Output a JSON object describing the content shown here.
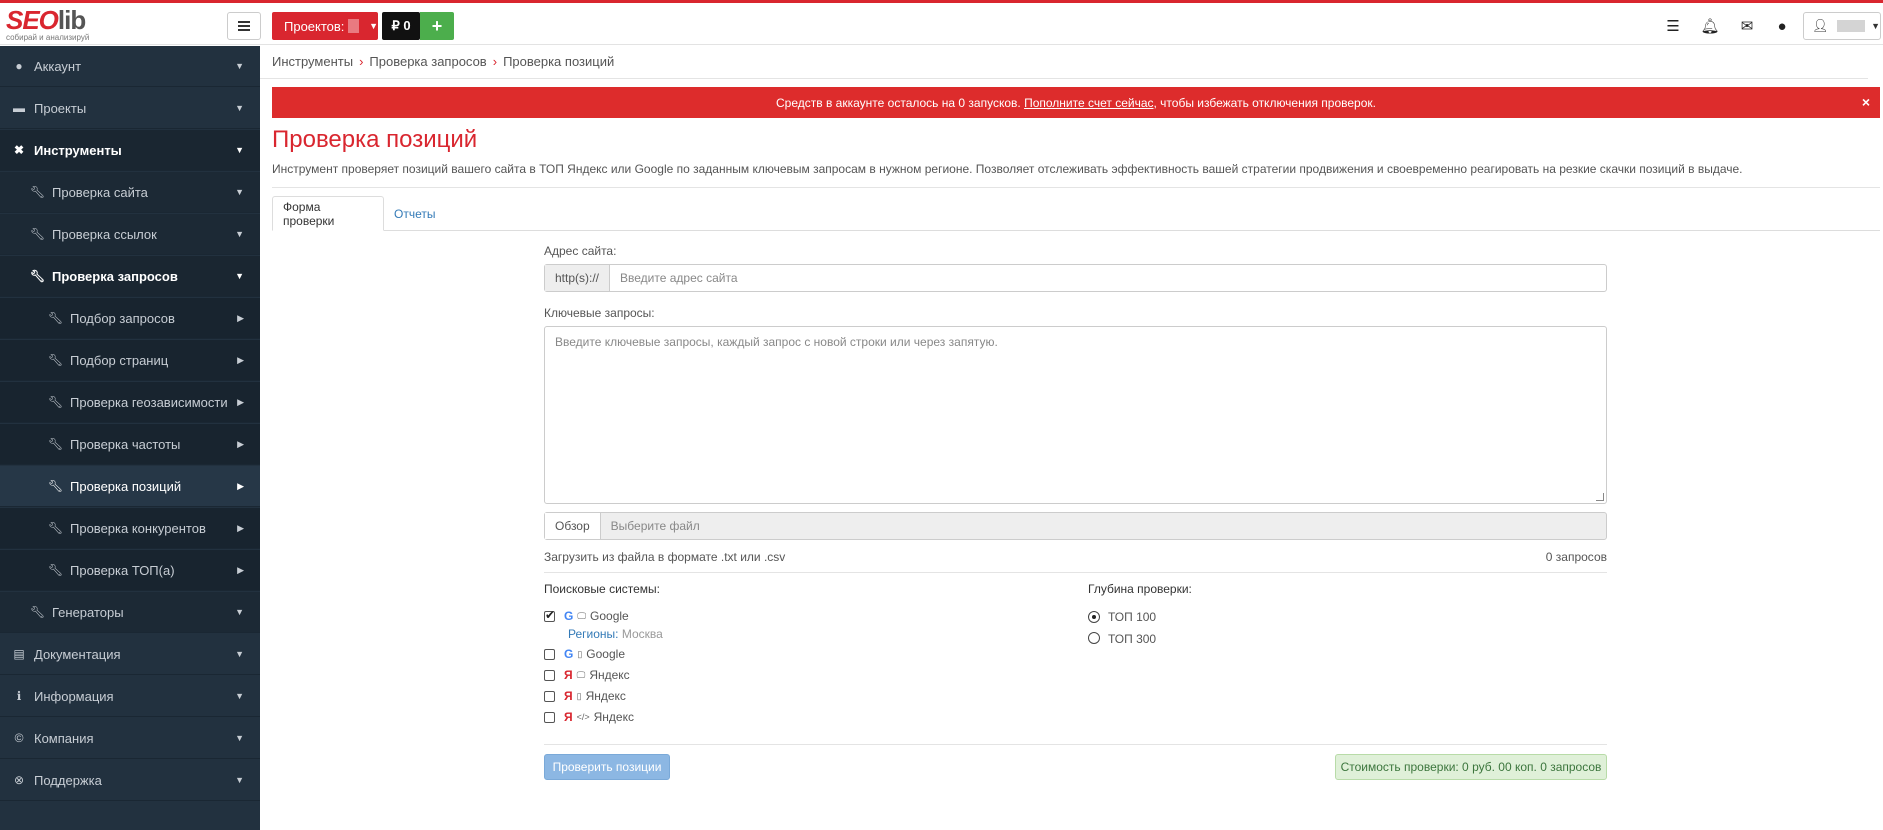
{
  "brand": {
    "logo_seo": "SEO",
    "logo_lib": "lib",
    "tagline": "собирай и анализируй"
  },
  "topbar": {
    "projects_label": "Проектов:",
    "balance_label": "₽ 0",
    "add_label": "+",
    "icons": [
      "checklist-icon",
      "bell-icon",
      "envelope-icon",
      "chat-icon",
      "user-icon"
    ]
  },
  "sidebar": {
    "items": [
      {
        "label": "Аккаунт",
        "icon": "user-icon"
      },
      {
        "label": "Проекты",
        "icon": "briefcase-icon"
      },
      {
        "label": "Инструменты",
        "icon": "tools-icon"
      },
      {
        "label": "Проверка сайта",
        "icon": "wrench-icon"
      },
      {
        "label": "Проверка ссылок",
        "icon": "wrench-icon"
      },
      {
        "label": "Проверка запросов",
        "icon": "wrench-icon"
      },
      {
        "label": "Подбор запросов",
        "icon": "wrench-icon"
      },
      {
        "label": "Подбор страниц",
        "icon": "wrench-icon"
      },
      {
        "label": "Проверка геозависимости",
        "icon": "wrench-icon"
      },
      {
        "label": "Проверка частоты",
        "icon": "wrench-icon"
      },
      {
        "label": "Проверка позиций",
        "icon": "wrench-icon"
      },
      {
        "label": "Проверка конкурентов",
        "icon": "wrench-icon"
      },
      {
        "label": "Проверка ТОП(а)",
        "icon": "wrench-icon"
      },
      {
        "label": "Генераторы",
        "icon": "wrench-icon"
      },
      {
        "label": "Документация",
        "icon": "document-icon"
      },
      {
        "label": "Информация",
        "icon": "info-icon"
      },
      {
        "label": "Компания",
        "icon": "copyright-icon"
      },
      {
        "label": "Поддержка",
        "icon": "lifebuoy-icon"
      }
    ]
  },
  "breadcrumb": [
    "Инструменты",
    "Проверка запросов",
    "Проверка позиций"
  ],
  "alert": {
    "before": "Средств в аккаунте осталось на 0 запусков. ",
    "link": "Пополните счет сейчас",
    "after": ", чтобы избежать отключения проверок.",
    "close": "×"
  },
  "page": {
    "title": "Проверка позиций",
    "description": "Инструмент проверяет позиций вашего сайта в ТОП Яндекс или Google по заданным ключевым запросам в нужном регионе. Позволяет отслеживать эффективность вашей стратегии продвижения и своевременно реагировать на резкие скачки позиций в выдаче."
  },
  "tabs": [
    "Форма проверки",
    "Отчеты"
  ],
  "form": {
    "site_label": "Адрес сайта:",
    "site_prefix": "http(s)://",
    "site_placeholder": "Введите адрес сайта",
    "keywords_label": "Ключевые запросы:",
    "keywords_placeholder": "Введите ключевые запросы, каждый запрос с новой строки или через запятую.",
    "browse_label": "Обзор",
    "file_placeholder": "Выберите файл",
    "file_hint": "Загрузить из файла в формате .txt или .csv",
    "query_count": "0 запросов",
    "engines_label": "Поисковые системы:",
    "engines": [
      {
        "name": "Google",
        "checked": true,
        "letter": "G",
        "device": "desktop-icon",
        "device_glyph": "🖵"
      },
      {
        "name": "Google",
        "checked": false,
        "letter": "G",
        "device": "mobile-icon",
        "device_glyph": "▯"
      },
      {
        "name": "Яндекс",
        "checked": false,
        "letter": "Я",
        "device": "desktop-icon",
        "device_glyph": "🖵"
      },
      {
        "name": "Яндекс",
        "checked": false,
        "letter": "Я",
        "device": "mobile-icon",
        "device_glyph": "▯"
      },
      {
        "name": "Яндекс",
        "checked": false,
        "letter": "Я",
        "device": "code-icon",
        "device_glyph": "</>"
      }
    ],
    "regions_label": "Регионы:",
    "region_city": "Москва",
    "depth_label": "Глубина проверки:",
    "depth_options": [
      {
        "label": "ТОП 100",
        "checked": true
      },
      {
        "label": "ТОП 300",
        "checked": false
      }
    ],
    "submit_label": "Проверить позиции",
    "cost_label": "Стоимость проверки: 0 руб. 00 коп. 0 запросов"
  },
  "colors": {
    "accent": "#d9262f",
    "sidebar": "#22313f",
    "link": "#337ab7",
    "google": "#4285f4",
    "success_bg": "#dff0d8"
  }
}
